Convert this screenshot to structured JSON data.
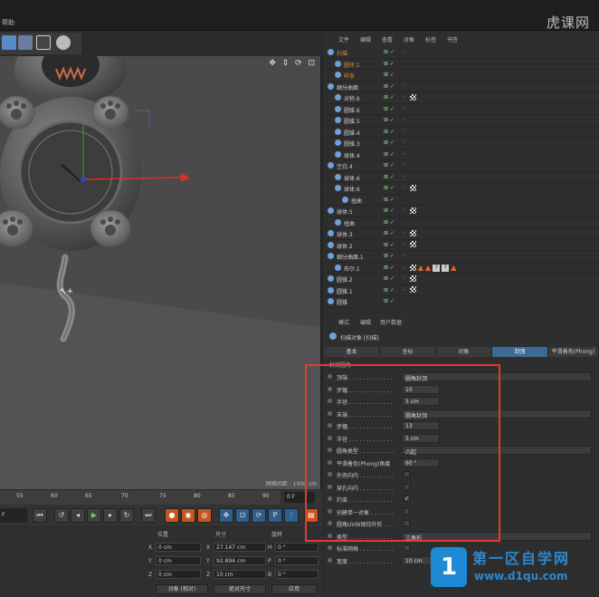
{
  "topbar": {
    "help": "帮助"
  },
  "watermark_top": "虎课网",
  "viewport": {
    "nav_icons": "✥ ⇕ ⟳ ⊡",
    "footer": "网格间距 : 1000 cm"
  },
  "timeline": {
    "ticks": [
      "55",
      "60",
      "65",
      "70",
      "75",
      "80",
      "85",
      "90"
    ],
    "fps": "0 F",
    "frame_left": "F"
  },
  "coords": {
    "headers": {
      "position": "位置",
      "size": "尺寸",
      "rotation": "旋转"
    },
    "rows": [
      {
        "axis": "X",
        "pos": "0 cm",
        "size_axis": "X",
        "size": "27.147 cm",
        "rot_axis": "H",
        "rot": "0 °"
      },
      {
        "axis": "Y",
        "pos": "0 cm",
        "size_axis": "Y",
        "size": "92.894 cm",
        "rot_axis": "P",
        "rot": "0 °"
      },
      {
        "axis": "Z",
        "pos": "0 cm",
        "size_axis": "Z",
        "size": "10 cm",
        "rot_axis": "B",
        "rot": "0 °"
      }
    ],
    "object_mode": "对象 (相对)",
    "size_mode": "绝对尺寸",
    "apply": "应用"
  },
  "objmgr": {
    "menu": [
      "文件",
      "编辑",
      "查看",
      "对象",
      "标签",
      "书签"
    ],
    "rows": [
      {
        "name": "扫描",
        "indent": 0,
        "color": "orange",
        "tag": "dots"
      },
      {
        "name": "圆环.1",
        "indent": 1,
        "color": "orange",
        "tag": ""
      },
      {
        "name": "样条",
        "indent": 1,
        "color": "orange",
        "tag": ""
      },
      {
        "name": "细分曲面",
        "indent": 0,
        "color": "normal",
        "tag": "dots"
      },
      {
        "name": "对称.6",
        "indent": 1,
        "color": "normal",
        "tag": "dots-chk"
      },
      {
        "name": "圆锥.6",
        "indent": 1,
        "color": "normal",
        "tag": "dots"
      },
      {
        "name": "圆锥.5",
        "indent": 1,
        "color": "normal",
        "tag": "dots"
      },
      {
        "name": "圆锥.4",
        "indent": 1,
        "color": "normal",
        "tag": "dots"
      },
      {
        "name": "圆锥.3",
        "indent": 1,
        "color": "normal",
        "tag": "dots"
      },
      {
        "name": "球体.4",
        "indent": 1,
        "color": "normal",
        "tag": "dots"
      },
      {
        "name": "空白.4",
        "indent": 0,
        "color": "normal",
        "tag": "dots"
      },
      {
        "name": "球体.6",
        "indent": 1,
        "color": "normal",
        "tag": "dots"
      },
      {
        "name": "球体.6",
        "indent": 1,
        "color": "normal",
        "tag": "dots-chk"
      },
      {
        "name": "扭曲",
        "indent": 2,
        "color": "normal",
        "tag": ""
      },
      {
        "name": "球体.5",
        "indent": 0,
        "color": "normal",
        "tag": "dots-chk"
      },
      {
        "name": "扭曲",
        "indent": 1,
        "color": "normal",
        "tag": ""
      },
      {
        "name": "球体.3",
        "indent": 0,
        "color": "normal",
        "tag": "dots-chk"
      },
      {
        "name": "球体.2",
        "indent": 0,
        "color": "normal",
        "tag": "dots-chk"
      },
      {
        "name": "细分曲面.1",
        "indent": 0,
        "color": "normal",
        "tag": "dots"
      },
      {
        "name": "布尔.1",
        "indent": 1,
        "color": "normal",
        "tag": "warn"
      },
      {
        "name": "圆锥.2",
        "indent": 0,
        "color": "normal",
        "tag": "dots-chk"
      },
      {
        "name": "圆锥.1",
        "indent": 0,
        "color": "normal",
        "tag": "dots-chk"
      },
      {
        "name": "圆锥",
        "indent": 0,
        "color": "normal",
        "tag": ""
      }
    ]
  },
  "attrmgr": {
    "menu": [
      "模式",
      "编辑",
      "用户数据"
    ],
    "object_title": "扫描对象 [扫描]",
    "tabs": [
      "基本",
      "坐标",
      "对象",
      "封顶",
      "平滑着色(Phong)"
    ],
    "active_tab": 3,
    "section": "封顶圆角",
    "params": [
      {
        "label": "顶端 . . . . . . . . . . . . .",
        "value": "圆角封顶",
        "type": "wide"
      },
      {
        "label": "步幅 . . . . . . . . . . . . .",
        "value": "10",
        "type": "num"
      },
      {
        "label": "半径 . . . . . . . . . . . . .",
        "value": "5 cm",
        "type": "num"
      },
      {
        "label": "末端 . . . . . . . . . . . . .",
        "value": "圆角封顶",
        "type": "wide"
      },
      {
        "label": "步幅 . . . . . . . . . . . . .",
        "value": "13",
        "type": "num"
      },
      {
        "label": "半径 . . . . . . . . . . . . .",
        "value": "5 cm",
        "type": "num"
      },
      {
        "label": "圆角类型 . . . . . . . . . .",
        "value": "凸起",
        "type": "wide"
      },
      {
        "label": "平滑着色(Phong)角度",
        "value": "60 °",
        "type": "num"
      },
      {
        "label": "外壳向内 . . . . . . . . . .",
        "value": "",
        "type": "check"
      },
      {
        "label": "穿孔向内 . . . . . . . . . .",
        "value": "",
        "type": "check"
      },
      {
        "label": "约束 . . . . . . . . . . . . .",
        "value": "✓",
        "type": "check"
      },
      {
        "label": "创建单一对象 . . . . . . .",
        "value": "",
        "type": "check"
      },
      {
        "label": "圆角UVW保持外形 . . .",
        "value": "",
        "type": "check"
      },
      {
        "label": "类型 . . . . . . . . . . . . .",
        "value": "三角形",
        "type": "wide"
      },
      {
        "label": "标准网格 . . . . . . . . . .",
        "value": "",
        "type": "check"
      },
      {
        "label": "宽度 . . . . . . . . . . . . .",
        "value": "10 cm",
        "type": "num"
      }
    ]
  },
  "brand": {
    "logo": "1",
    "name": "第一区自学网",
    "url": "www.d1qu.com"
  },
  "colors": {
    "accent_tab": "#3d6b95",
    "highlight_box": "#e43a2f",
    "brand": "#2c88cf"
  }
}
